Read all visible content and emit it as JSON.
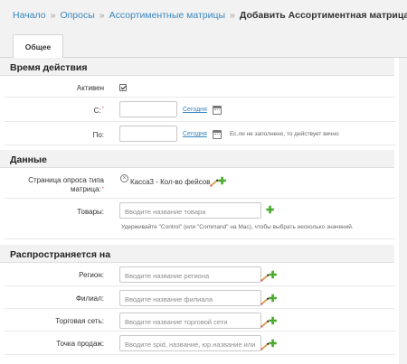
{
  "breadcrumbs": {
    "home": "Начало",
    "surveys": "Опросы",
    "matrices": "Ассортиментные матрицы",
    "separator": "»",
    "current": "Добавить Ассортиментная матрица"
  },
  "tabs": {
    "general": "Общее"
  },
  "sections": {
    "period": {
      "title": "Время действия",
      "active_label": "Активен",
      "active_checked": true,
      "from_label": "С:",
      "from_value": "",
      "to_label": "По:",
      "to_value": "",
      "today_link": "Сегодня",
      "to_hint": "Ес.ли не заполнено, то действует вечно"
    },
    "data": {
      "title": "Данные",
      "page_label_line1": "Страница опроса типа",
      "page_label_line2": "матрица:",
      "page_value": "Касса3 - Кол-во фейсов",
      "goods_label": "Товары:",
      "goods_placeholder": "Вводите название товара",
      "goods_hint": "Удерживайте \"Control\" (или \"Command\" на Mac), чтобы выбрать несколько значений."
    },
    "scope": {
      "title": "Распространяется на",
      "region_label": "Регион:",
      "region_placeholder": "Вводите название региона",
      "branch_label": "Филиал:",
      "branch_placeholder": "Вводите название филиала",
      "network_label": "Торговая сеть:",
      "network_placeholder": "Вводите название торговой сети",
      "pos_label": "Точка продаж:",
      "pos_placeholder": "Вводите spid, название, юр.название или"
    }
  },
  "required_mark": "*",
  "icons": {
    "calendar": "calendar-icon",
    "edit": "pencil-icon",
    "add": "plus-icon",
    "remove": "remove-icon"
  },
  "colors": {
    "link": "#3a87c0",
    "add_green": "#4caa2e",
    "required_red": "#e16565"
  }
}
